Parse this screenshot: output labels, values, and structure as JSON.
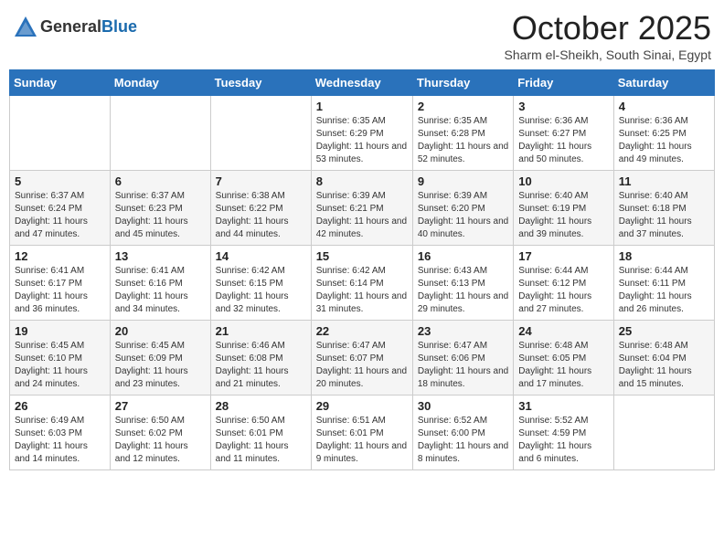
{
  "header": {
    "logo_general": "General",
    "logo_blue": "Blue",
    "month": "October 2025",
    "location": "Sharm el-Sheikh, South Sinai, Egypt"
  },
  "days_of_week": [
    "Sunday",
    "Monday",
    "Tuesday",
    "Wednesday",
    "Thursday",
    "Friday",
    "Saturday"
  ],
  "weeks": [
    [
      {
        "day": "",
        "info": ""
      },
      {
        "day": "",
        "info": ""
      },
      {
        "day": "",
        "info": ""
      },
      {
        "day": "1",
        "info": "Sunrise: 6:35 AM\nSunset: 6:29 PM\nDaylight: 11 hours and 53 minutes."
      },
      {
        "day": "2",
        "info": "Sunrise: 6:35 AM\nSunset: 6:28 PM\nDaylight: 11 hours and 52 minutes."
      },
      {
        "day": "3",
        "info": "Sunrise: 6:36 AM\nSunset: 6:27 PM\nDaylight: 11 hours and 50 minutes."
      },
      {
        "day": "4",
        "info": "Sunrise: 6:36 AM\nSunset: 6:25 PM\nDaylight: 11 hours and 49 minutes."
      }
    ],
    [
      {
        "day": "5",
        "info": "Sunrise: 6:37 AM\nSunset: 6:24 PM\nDaylight: 11 hours and 47 minutes."
      },
      {
        "day": "6",
        "info": "Sunrise: 6:37 AM\nSunset: 6:23 PM\nDaylight: 11 hours and 45 minutes."
      },
      {
        "day": "7",
        "info": "Sunrise: 6:38 AM\nSunset: 6:22 PM\nDaylight: 11 hours and 44 minutes."
      },
      {
        "day": "8",
        "info": "Sunrise: 6:39 AM\nSunset: 6:21 PM\nDaylight: 11 hours and 42 minutes."
      },
      {
        "day": "9",
        "info": "Sunrise: 6:39 AM\nSunset: 6:20 PM\nDaylight: 11 hours and 40 minutes."
      },
      {
        "day": "10",
        "info": "Sunrise: 6:40 AM\nSunset: 6:19 PM\nDaylight: 11 hours and 39 minutes."
      },
      {
        "day": "11",
        "info": "Sunrise: 6:40 AM\nSunset: 6:18 PM\nDaylight: 11 hours and 37 minutes."
      }
    ],
    [
      {
        "day": "12",
        "info": "Sunrise: 6:41 AM\nSunset: 6:17 PM\nDaylight: 11 hours and 36 minutes."
      },
      {
        "day": "13",
        "info": "Sunrise: 6:41 AM\nSunset: 6:16 PM\nDaylight: 11 hours and 34 minutes."
      },
      {
        "day": "14",
        "info": "Sunrise: 6:42 AM\nSunset: 6:15 PM\nDaylight: 11 hours and 32 minutes."
      },
      {
        "day": "15",
        "info": "Sunrise: 6:42 AM\nSunset: 6:14 PM\nDaylight: 11 hours and 31 minutes."
      },
      {
        "day": "16",
        "info": "Sunrise: 6:43 AM\nSunset: 6:13 PM\nDaylight: 11 hours and 29 minutes."
      },
      {
        "day": "17",
        "info": "Sunrise: 6:44 AM\nSunset: 6:12 PM\nDaylight: 11 hours and 27 minutes."
      },
      {
        "day": "18",
        "info": "Sunrise: 6:44 AM\nSunset: 6:11 PM\nDaylight: 11 hours and 26 minutes."
      }
    ],
    [
      {
        "day": "19",
        "info": "Sunrise: 6:45 AM\nSunset: 6:10 PM\nDaylight: 11 hours and 24 minutes."
      },
      {
        "day": "20",
        "info": "Sunrise: 6:45 AM\nSunset: 6:09 PM\nDaylight: 11 hours and 23 minutes."
      },
      {
        "day": "21",
        "info": "Sunrise: 6:46 AM\nSunset: 6:08 PM\nDaylight: 11 hours and 21 minutes."
      },
      {
        "day": "22",
        "info": "Sunrise: 6:47 AM\nSunset: 6:07 PM\nDaylight: 11 hours and 20 minutes."
      },
      {
        "day": "23",
        "info": "Sunrise: 6:47 AM\nSunset: 6:06 PM\nDaylight: 11 hours and 18 minutes."
      },
      {
        "day": "24",
        "info": "Sunrise: 6:48 AM\nSunset: 6:05 PM\nDaylight: 11 hours and 17 minutes."
      },
      {
        "day": "25",
        "info": "Sunrise: 6:48 AM\nSunset: 6:04 PM\nDaylight: 11 hours and 15 minutes."
      }
    ],
    [
      {
        "day": "26",
        "info": "Sunrise: 6:49 AM\nSunset: 6:03 PM\nDaylight: 11 hours and 14 minutes."
      },
      {
        "day": "27",
        "info": "Sunrise: 6:50 AM\nSunset: 6:02 PM\nDaylight: 11 hours and 12 minutes."
      },
      {
        "day": "28",
        "info": "Sunrise: 6:50 AM\nSunset: 6:01 PM\nDaylight: 11 hours and 11 minutes."
      },
      {
        "day": "29",
        "info": "Sunrise: 6:51 AM\nSunset: 6:01 PM\nDaylight: 11 hours and 9 minutes."
      },
      {
        "day": "30",
        "info": "Sunrise: 6:52 AM\nSunset: 6:00 PM\nDaylight: 11 hours and 8 minutes."
      },
      {
        "day": "31",
        "info": "Sunrise: 5:52 AM\nSunset: 4:59 PM\nDaylight: 11 hours and 6 minutes."
      },
      {
        "day": "",
        "info": ""
      }
    ]
  ]
}
